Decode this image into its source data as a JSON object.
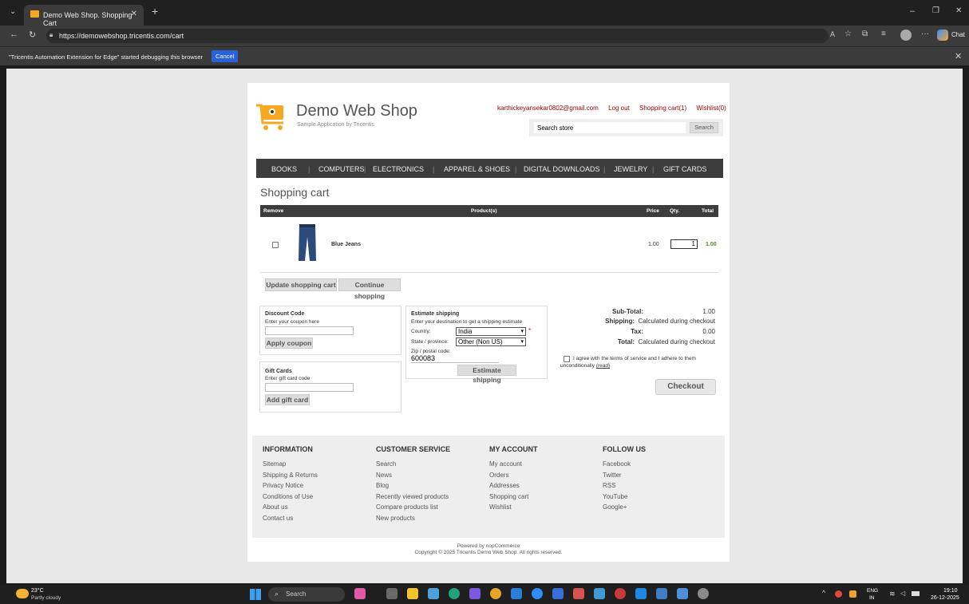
{
  "browser": {
    "tab_title": "Demo Web Shop. Shopping Cart",
    "url": "https://demowebshop.tricentis.com/cart",
    "chat_label": "Chat",
    "debug_message": "\"Tricentis Automation Extension for Edge\" started debugging this browser",
    "debug_cancel": "Cancel"
  },
  "header": {
    "logo_title": "Demo Web Shop",
    "logo_subtitle": "Sample Application by Tricentis",
    "email": "karthickeyansekar0802@gmail.com",
    "logout": "Log out",
    "cart_link": "Shopping cart(1)",
    "wishlist_link": "Wishlist(0)",
    "search_value": "Search store",
    "search_button": "Search"
  },
  "nav": [
    "BOOKS",
    "COMPUTERS",
    "ELECTRONICS",
    "APPAREL & SHOES",
    "DIGITAL DOWNLOADS",
    "JEWELRY",
    "GIFT CARDS"
  ],
  "cart": {
    "title": "Shopping cart",
    "columns": {
      "remove": "Remove",
      "product": "Product(s)",
      "price": "Price",
      "qty": "Qty.",
      "total": "Total"
    },
    "item": {
      "name": "Blue Jeans",
      "price": "1.00",
      "qty": "1",
      "total": "1.00"
    },
    "update_button": "Update shopping cart",
    "continue_button": "Continue shopping"
  },
  "discount": {
    "title": "Discount Code",
    "hint": "Enter your coupon here",
    "button": "Apply coupon"
  },
  "giftcard": {
    "title": "Gift Cards",
    "hint": "Enter gift card code",
    "button": "Add gift card"
  },
  "shipping": {
    "title": "Estimate shipping",
    "hint": "Enter your destination to get a shipping estimate",
    "country_label": "Country:",
    "country_value": "India",
    "required_mark": "*",
    "state_label": "State / province:",
    "state_value": "Other (Non US)",
    "zip_label": "Zip / postal code:",
    "zip_value": "600083",
    "button": "Estimate shipping"
  },
  "totals": {
    "subtotal_label": "Sub-Total:",
    "subtotal_value": "1.00",
    "shipping_label": "Shipping:",
    "shipping_value": "Calculated during checkout",
    "tax_label": "Tax:",
    "tax_value": "0.00",
    "total_label": "Total:",
    "total_value": "Calculated during checkout",
    "terms_text": "I agree with the terms of service and I adhere to them unconditionally",
    "terms_link": "(read)",
    "checkout_button": "Checkout"
  },
  "footer": {
    "columns": [
      {
        "title": "INFORMATION",
        "items": [
          "Sitemap",
          "Shipping & Returns",
          "Privacy Notice",
          "Conditions of Use",
          "About us",
          "Contact us"
        ]
      },
      {
        "title": "CUSTOMER SERVICE",
        "items": [
          "Search",
          "News",
          "Blog",
          "Recently viewed products",
          "Compare products list",
          "New products"
        ]
      },
      {
        "title": "MY ACCOUNT",
        "items": [
          "My account",
          "Orders",
          "Addresses",
          "Shopping cart",
          "Wishlist"
        ]
      },
      {
        "title": "FOLLOW US",
        "items": [
          "Facebook",
          "Twitter",
          "RSS",
          "YouTube",
          "Google+"
        ]
      }
    ],
    "powered": "Powered by nopCommerce",
    "copyright": "Copyright © 2025 Tricentis Demo Web Shop. All rights reserved."
  },
  "taskbar": {
    "weather_temp": "23°C",
    "weather_desc": "Partly cloudy",
    "search_label": "Search",
    "lang": "ENG",
    "region": "IN",
    "time": "19:10",
    "date": "26-12-2025"
  },
  "colors": {
    "accent": "#990000",
    "nav_bg": "#3c3c3c",
    "total_green": "#4a8a1d"
  }
}
